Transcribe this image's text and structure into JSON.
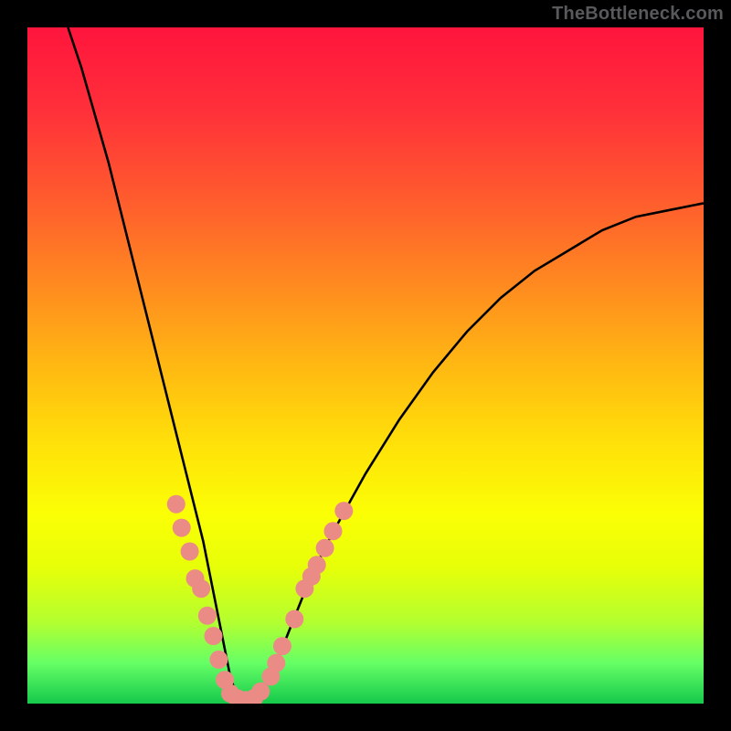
{
  "attribution": "TheBottleneck.com",
  "chart_data": {
    "type": "line",
    "title": "",
    "xlabel": "",
    "ylabel": "",
    "xlim": [
      0,
      100
    ],
    "ylim": [
      0,
      100
    ],
    "grid": false,
    "legend": false,
    "series": [
      {
        "name": "curve",
        "color": "#000000",
        "x": [
          6,
          8,
          10,
          12,
          14,
          16,
          18,
          20,
          22,
          24,
          25,
          26,
          27,
          28,
          29,
          30,
          31,
          32,
          33,
          34,
          36,
          38,
          40,
          42,
          45,
          50,
          55,
          60,
          65,
          70,
          75,
          80,
          85,
          90,
          95,
          100
        ],
        "y": [
          100,
          94,
          87,
          80,
          72,
          64,
          56,
          48,
          40,
          32,
          28,
          24,
          19,
          14,
          9,
          4,
          1,
          0,
          0,
          1,
          4,
          9,
          14,
          19,
          25,
          34,
          42,
          49,
          55,
          60,
          64,
          67,
          70,
          72,
          73,
          74
        ]
      }
    ],
    "markers": [
      {
        "name": "dots",
        "color": "#eb8b85",
        "radius": 10,
        "points": [
          {
            "x": 22.0,
            "y": 29.5
          },
          {
            "x": 22.8,
            "y": 26.0
          },
          {
            "x": 24.0,
            "y": 22.5
          },
          {
            "x": 24.8,
            "y": 18.5
          },
          {
            "x": 25.7,
            "y": 17.0
          },
          {
            "x": 26.6,
            "y": 13.0
          },
          {
            "x": 27.5,
            "y": 10.0
          },
          {
            "x": 28.3,
            "y": 6.5
          },
          {
            "x": 29.2,
            "y": 3.5
          },
          {
            "x": 30.0,
            "y": 1.5
          },
          {
            "x": 31.0,
            "y": 0.8
          },
          {
            "x": 32.3,
            "y": 0.5
          },
          {
            "x": 33.5,
            "y": 0.8
          },
          {
            "x": 34.5,
            "y": 1.8
          },
          {
            "x": 36.0,
            "y": 4.0
          },
          {
            "x": 36.8,
            "y": 6.0
          },
          {
            "x": 37.7,
            "y": 8.5
          },
          {
            "x": 39.5,
            "y": 12.5
          },
          {
            "x": 41.0,
            "y": 17.0
          },
          {
            "x": 42.0,
            "y": 18.8
          },
          {
            "x": 42.8,
            "y": 20.5
          },
          {
            "x": 44.0,
            "y": 23.0
          },
          {
            "x": 45.2,
            "y": 25.5
          },
          {
            "x": 46.8,
            "y": 28.5
          }
        ]
      }
    ]
  }
}
